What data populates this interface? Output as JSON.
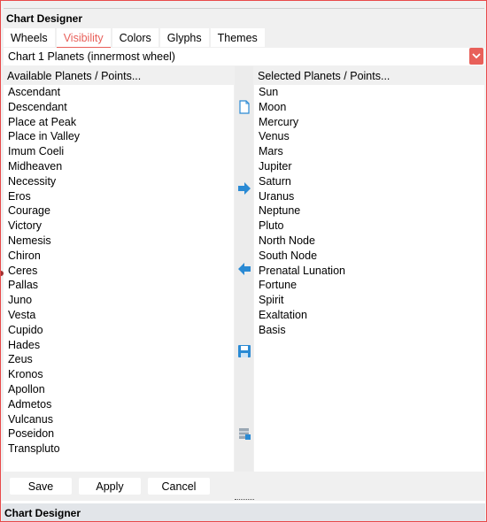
{
  "window": {
    "title": "Chart Designer"
  },
  "tabs": [
    {
      "label": "Wheels",
      "active": false
    },
    {
      "label": "Visibility",
      "active": true
    },
    {
      "label": "Colors",
      "active": false
    },
    {
      "label": "Glyphs",
      "active": false
    },
    {
      "label": "Themes",
      "active": false
    }
  ],
  "wheel_select": {
    "value": "Chart 1 Planets (innermost wheel)",
    "icon": "chevron-down-icon"
  },
  "available": {
    "header": "Available Planets / Points...",
    "items": [
      "Ascendant",
      "Descendant",
      "Place at Peak",
      "Place in Valley",
      "Imum Coeli",
      "Midheaven",
      "Necessity",
      "Eros",
      "Courage",
      "Victory",
      "Nemesis",
      "Chiron",
      "Ceres",
      "Pallas",
      "Juno",
      "Vesta",
      "Cupido",
      "Hades",
      "Zeus",
      "Kronos",
      "Apollon",
      "Admetos",
      "Vulcanus",
      "Poseidon",
      "Transpluto"
    ]
  },
  "selected": {
    "header": "Selected Planets / Points...",
    "items": [
      "Sun",
      "Moon",
      "Mercury",
      "Venus",
      "Mars",
      "Jupiter",
      "Saturn",
      "Uranus",
      "Neptune",
      "Pluto",
      "North Node",
      "South Node",
      "Prenatal Lunation",
      "Fortune",
      "Spirit",
      "Exaltation",
      "Basis"
    ]
  },
  "middle_toolbar": {
    "icons": [
      "new-document-icon",
      "arrow-right-icon",
      "arrow-left-icon",
      "save-icon",
      "database-icon"
    ]
  },
  "buttons": {
    "save": "Save",
    "apply": "Apply",
    "cancel": "Cancel"
  },
  "footer": {
    "title": "Chart Designer"
  },
  "colors": {
    "accent": "#e8605a",
    "icon_blue": "#2a8ad4",
    "frame": "#e84a4a"
  }
}
